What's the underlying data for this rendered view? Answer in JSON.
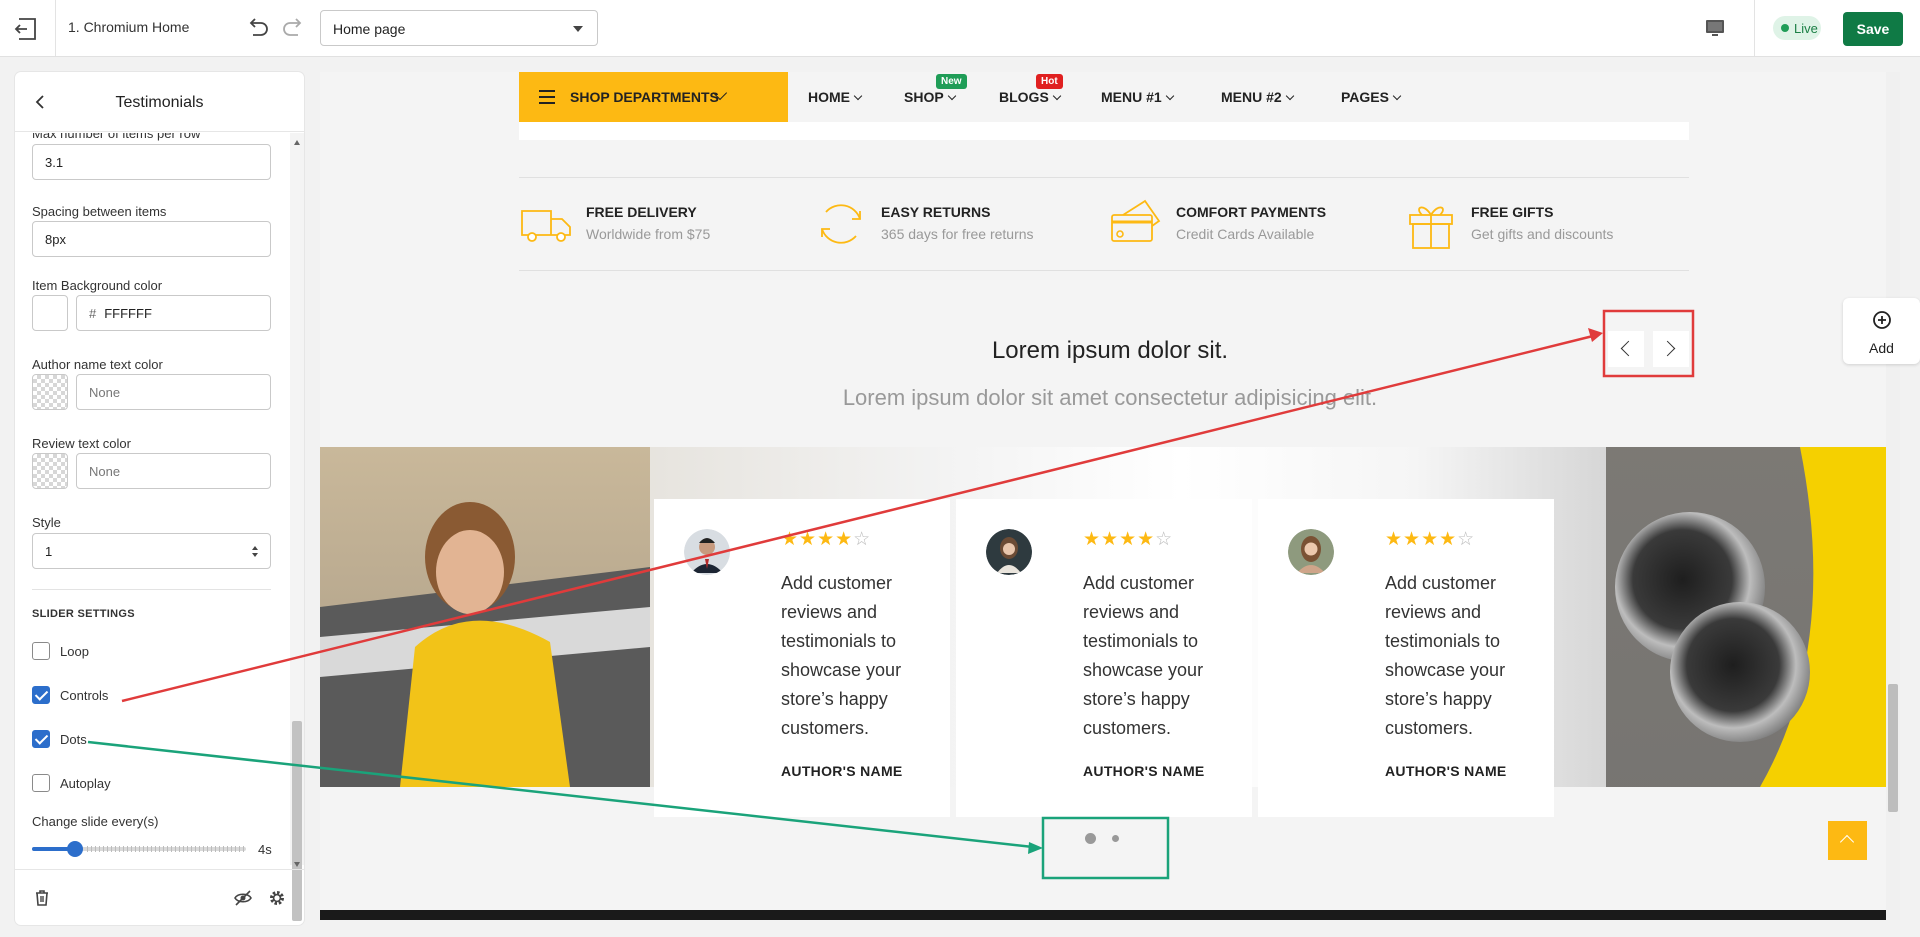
{
  "topbar": {
    "title": "1. Chromium Home",
    "page_select": "Home page",
    "live_label": "Live",
    "save_label": "Save",
    "exit_icon": "exit-icon",
    "device_icon": "desktop-icon"
  },
  "panel": {
    "title": "Testimonials",
    "fields": {
      "max_items_label": "Max number of items per row",
      "max_items_value": "3.1",
      "spacing_label": "Spacing between items",
      "spacing_value": "8px",
      "bg_color_label": "Item Background color",
      "bg_color_value": "FFFFFF",
      "author_color_label": "Author name text color",
      "author_color_value": "None",
      "review_color_label": "Review text color",
      "review_color_value": "None",
      "style_label": "Style",
      "style_value": "1"
    },
    "slider_section": "SLIDER SETTINGS",
    "checkboxes": [
      {
        "label": "Loop",
        "checked": false
      },
      {
        "label": "Controls",
        "checked": true
      },
      {
        "label": "Dots",
        "checked": true
      },
      {
        "label": "Autoplay",
        "checked": false
      }
    ],
    "change_slide_label": "Change slide every(s)",
    "change_slide_value": "4s",
    "change_slide_fraction": 0.2
  },
  "canvas": {
    "nav": {
      "shop_departments": "SHOP DEPARTMENTS",
      "items": [
        {
          "label": "HOME",
          "badge": ""
        },
        {
          "label": "SHOP",
          "badge": "New",
          "badge_color": "#1f9d57"
        },
        {
          "label": "BLOGS",
          "badge": "Hot",
          "badge_color": "#e02020"
        },
        {
          "label": "MENU #1",
          "badge": ""
        },
        {
          "label": "MENU #2",
          "badge": ""
        },
        {
          "label": "PAGES",
          "badge": ""
        }
      ]
    },
    "features": [
      {
        "title": "FREE DELIVERY",
        "subtitle": "Worldwide from $75",
        "icon": "truck-icon"
      },
      {
        "title": "EASY RETURNS",
        "subtitle": "365 days for free returns",
        "icon": "returns-icon"
      },
      {
        "title": "COMFORT PAYMENTS",
        "subtitle": "Credit Cards Available",
        "icon": "credit-card-icon"
      },
      {
        "title": "FREE GIFTS",
        "subtitle": "Get gifts and discounts",
        "icon": "gift-icon"
      }
    ],
    "heading": "Lorem ipsum dolor sit.",
    "subheading": "Lorem ipsum dolor sit amet consectetur adipisicing elit.",
    "cards": [
      {
        "review": "Add customer reviews and testimonials to showcase your store’s happy customers.",
        "author": "AUTHOR'S NAME",
        "rating": 4
      },
      {
        "review": "Add customer reviews and testimonials to showcase your store’s happy customers.",
        "author": "AUTHOR'S NAME",
        "rating": 4
      },
      {
        "review": "Add customer reviews and testimonials to showcase your store’s happy customers.",
        "author": "AUTHOR'S NAME",
        "rating": 4
      }
    ],
    "add_label": "Add"
  },
  "colors": {
    "accent_yellow": "#fdb913",
    "save_green": "#0f7a45",
    "checkbox_blue": "#2c6ecb",
    "annotation_red": "#e03b3b",
    "annotation_green": "#1aa37a"
  }
}
